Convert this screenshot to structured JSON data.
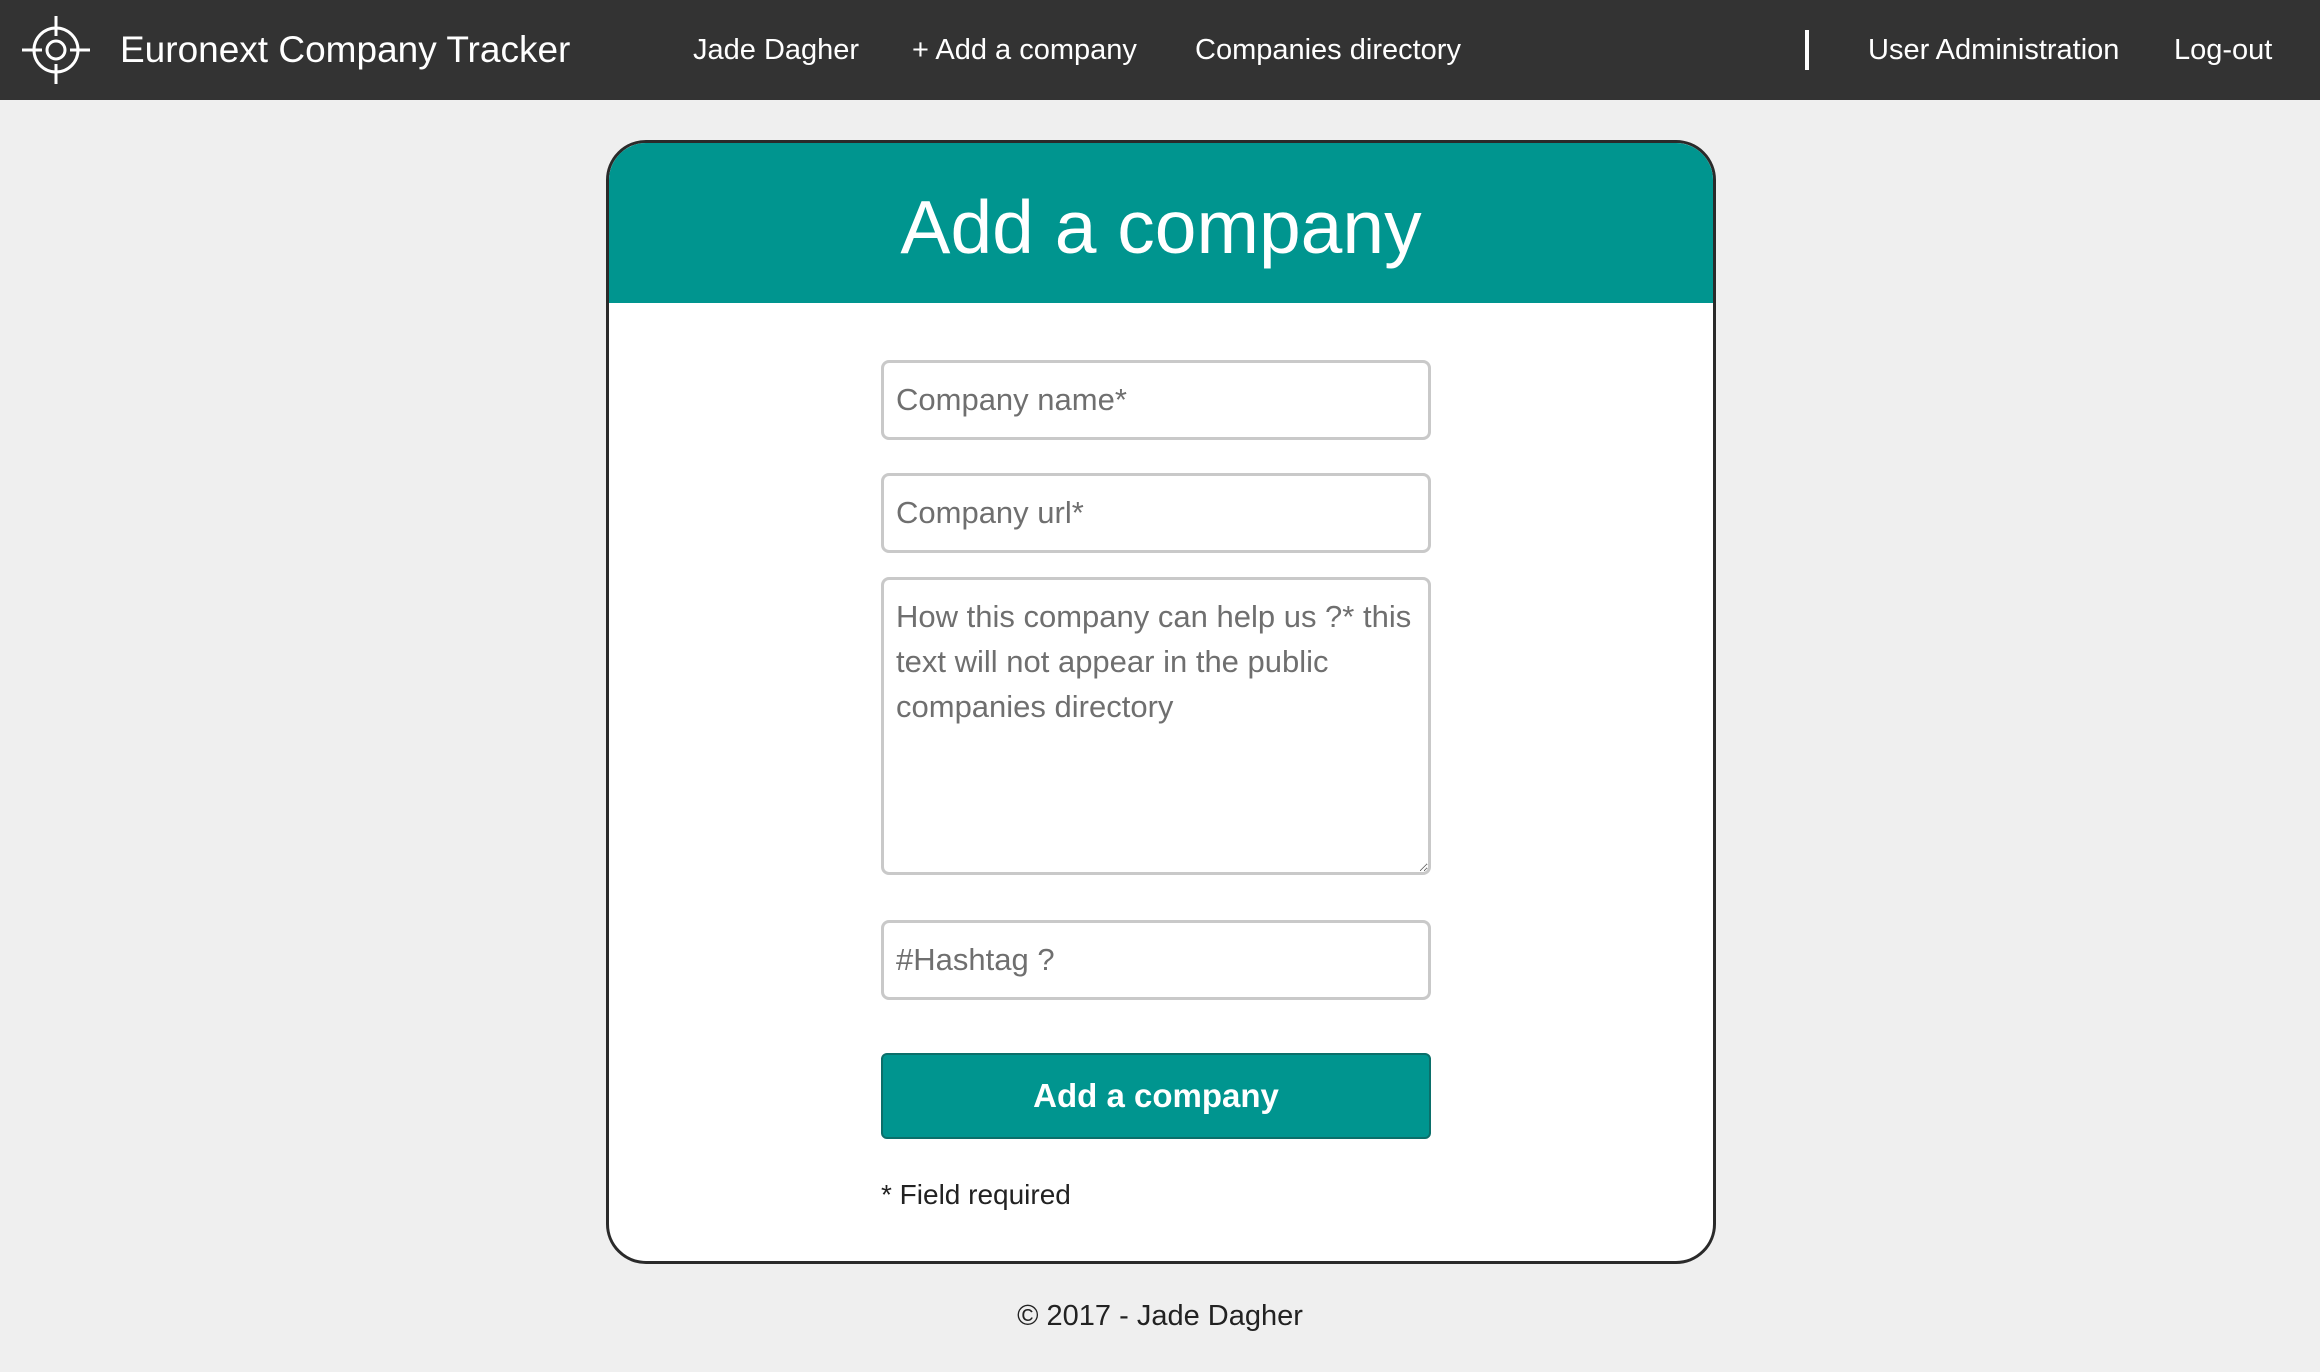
{
  "navbar": {
    "logo_icon": "crosshair-icon",
    "brand": "Euronext Company Tracker",
    "links": {
      "user": "Jade Dagher",
      "add_company": "+ Add a company",
      "directory": "Companies directory",
      "admin": "User Administration",
      "logout": "Log-out"
    },
    "background_color": "#333333"
  },
  "form": {
    "title": "Add a company",
    "header_color": "#00958f",
    "company_name": {
      "value": "",
      "placeholder": "Company name*"
    },
    "company_url": {
      "value": "",
      "placeholder": "Company url*"
    },
    "help": {
      "value": "",
      "placeholder": "How this company can help us ?* this text will not appear in the public companies directory"
    },
    "hashtag": {
      "value": "",
      "placeholder": "#Hashtag ?"
    },
    "submit_label": "Add a company",
    "required_note": "* Field required"
  },
  "footer": {
    "text": "© 2017 - Jade Dagher"
  }
}
